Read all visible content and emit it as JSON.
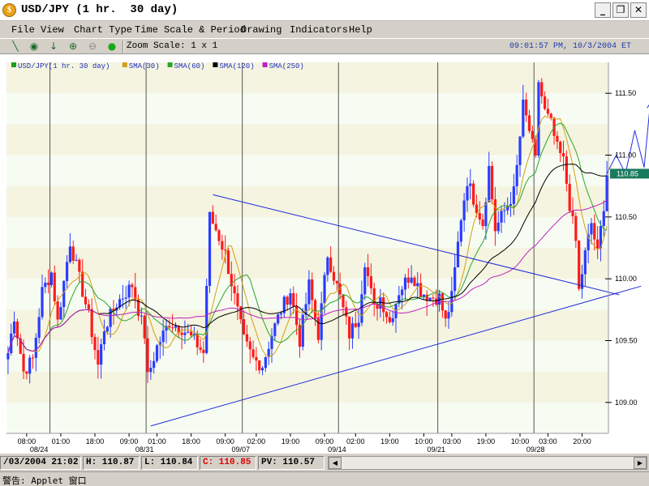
{
  "window": {
    "title": "USD/JPY (1 hr.  30 day)",
    "minimize": "_",
    "restore": "❐",
    "close": "✕"
  },
  "menu": [
    "File",
    "View",
    "Chart Type",
    "Time Scale & Period",
    "Drawing",
    "Indicators",
    "Help"
  ],
  "toolbar": {
    "zoom_label": "Zoom Scale: 1 x 1",
    "clock": "09:01:57 PM, 10/3/2004 ET",
    "icons": [
      "draw-line-icon",
      "crosshair-icon",
      "down-arrow-icon",
      "zoom-in-icon",
      "zoom-out-icon",
      "color-ball-icon"
    ]
  },
  "status": {
    "datetime": "/03/2004 21:02",
    "high": "H: 110.87",
    "low": "L: 110.84",
    "close": "C: 110.85",
    "pv": "PV: 110.57"
  },
  "bottom_warning": "警告: Applet 窗口",
  "chart_data": {
    "type": "candlestick",
    "title": "USD/JPY (1 hr.  30 day)",
    "legend": [
      {
        "name": "USD/JPY(1 hr.  30 day)",
        "color": "#18a018"
      },
      {
        "name": "SMA(30)",
        "color": "#d4a017"
      },
      {
        "name": "SMA(60)",
        "color": "#2aa62a"
      },
      {
        "name": "SMA(120)",
        "color": "#000000"
      },
      {
        "name": "SMA(250)",
        "color": "#c020c0"
      }
    ],
    "legend_placement": "top-left",
    "y_ticks": [
      "109.00",
      "109.50",
      "110.00",
      "110.50",
      "111.00",
      "111.50"
    ],
    "y_tick_values": [
      109.0,
      109.5,
      110.0,
      110.5,
      111.0,
      111.5
    ],
    "ylim": [
      108.75,
      111.75
    ],
    "last_price_label": "110.85",
    "last_price": 110.85,
    "x_ticks": [
      {
        "i": 6,
        "label": "08:00"
      },
      {
        "i": 17,
        "label": "01:00"
      },
      {
        "i": 28,
        "label": "18:00"
      },
      {
        "i": 39,
        "label": "09:00"
      },
      {
        "i": 48,
        "label": "01:00"
      },
      {
        "i": 59,
        "label": "18:00"
      },
      {
        "i": 70,
        "label": "09:00"
      },
      {
        "i": 80,
        "label": "02:00"
      },
      {
        "i": 91,
        "label": "19:00"
      },
      {
        "i": 102,
        "label": "09:00"
      },
      {
        "i": 112,
        "label": "02:00"
      },
      {
        "i": 123,
        "label": "19:00"
      },
      {
        "i": 134,
        "label": "10:00"
      },
      {
        "i": 143,
        "label": "03:00"
      },
      {
        "i": 154,
        "label": "19:00"
      },
      {
        "i": 165,
        "label": "10:00"
      },
      {
        "i": 174,
        "label": "03:00"
      },
      {
        "i": 185,
        "label": "20:00"
      }
    ],
    "date_labels": [
      {
        "i": 10,
        "label": "08/24"
      },
      {
        "i": 44,
        "label": "08/31"
      },
      {
        "i": 75,
        "label": "09/07"
      },
      {
        "i": 106,
        "label": "09/14"
      },
      {
        "i": 138,
        "label": "09/21"
      },
      {
        "i": 170,
        "label": "09/28"
      }
    ],
    "day_separators": [
      14,
      45,
      76,
      107,
      139,
      170
    ],
    "anchors": [
      [
        0,
        109.4
      ],
      [
        2,
        109.7
      ],
      [
        5,
        109.25
      ],
      [
        8,
        109.35
      ],
      [
        11,
        109.9
      ],
      [
        14,
        110.05
      ],
      [
        16,
        109.65
      ],
      [
        20,
        110.3
      ],
      [
        23,
        110.0
      ],
      [
        26,
        109.7
      ],
      [
        29,
        109.3
      ],
      [
        31,
        109.6
      ],
      [
        35,
        109.8
      ],
      [
        40,
        109.95
      ],
      [
        44,
        109.55
      ],
      [
        45,
        109.2
      ],
      [
        48,
        109.45
      ],
      [
        52,
        109.65
      ],
      [
        56,
        109.6
      ],
      [
        60,
        109.5
      ],
      [
        63,
        109.4
      ],
      [
        65,
        110.5
      ],
      [
        67,
        110.4
      ],
      [
        70,
        110.2
      ],
      [
        73,
        109.85
      ],
      [
        76,
        109.5
      ],
      [
        79,
        109.35
      ],
      [
        82,
        109.3
      ],
      [
        85,
        109.55
      ],
      [
        88,
        109.75
      ],
      [
        91,
        109.9
      ],
      [
        94,
        109.5
      ],
      [
        97,
        109.95
      ],
      [
        100,
        109.55
      ],
      [
        103,
        110.2
      ],
      [
        107,
        109.85
      ],
      [
        110,
        109.55
      ],
      [
        113,
        109.7
      ],
      [
        115,
        110.15
      ],
      [
        118,
        109.75
      ],
      [
        120,
        109.85
      ],
      [
        123,
        109.65
      ],
      [
        126,
        109.9
      ],
      [
        130,
        110.05
      ],
      [
        133,
        109.9
      ],
      [
        136,
        109.85
      ],
      [
        139,
        109.85
      ],
      [
        141,
        109.65
      ],
      [
        143,
        109.85
      ],
      [
        146,
        110.5
      ],
      [
        148,
        110.8
      ],
      [
        150,
        110.65
      ],
      [
        153,
        110.45
      ],
      [
        155,
        110.9
      ],
      [
        157,
        110.4
      ],
      [
        160,
        110.55
      ],
      [
        163,
        110.7
      ],
      [
        164,
        110.9
      ],
      [
        166,
        111.4
      ],
      [
        168,
        111.2
      ],
      [
        170,
        110.95
      ],
      [
        171,
        111.6
      ],
      [
        173,
        111.35
      ],
      [
        175,
        111.25
      ],
      [
        177,
        111.05
      ],
      [
        179,
        110.95
      ],
      [
        181,
        110.6
      ],
      [
        183,
        110.3
      ],
      [
        184,
        109.9
      ],
      [
        186,
        110.2
      ],
      [
        188,
        110.45
      ],
      [
        190,
        110.2
      ],
      [
        192,
        110.6
      ],
      [
        193,
        110.85
      ]
    ],
    "trendlines": [
      {
        "name": "upper",
        "from": [
          66,
          110.68
        ],
        "to": [
          197,
          109.87
        ]
      },
      {
        "name": "lower",
        "from": [
          46,
          108.81
        ],
        "to": [
          204,
          109.94
        ]
      }
    ],
    "projection": [
      [
        193,
        110.85
      ],
      [
        196,
        111.0
      ],
      [
        199,
        110.85
      ],
      [
        202,
        111.2
      ],
      [
        205,
        110.9
      ],
      [
        207,
        111.42
      ]
    ]
  }
}
